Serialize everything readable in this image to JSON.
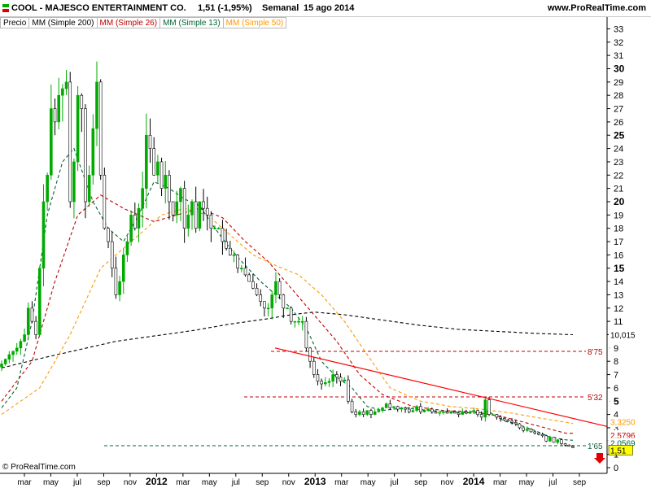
{
  "header": {
    "ticker": "COOL - MAJESCO ENTERTAINMENT CO.",
    "last": "1,51 (-1,95%)",
    "period": "Semanal",
    "date": "15 ago 2014",
    "site": "www.ProRealTime.com"
  },
  "legend": {
    "items": [
      {
        "label": "Precio",
        "color": "#000000"
      },
      {
        "label": "MM (Simple 200)",
        "color": "#000000"
      },
      {
        "label": "MM (Simple 26)",
        "color": "#c00000"
      },
      {
        "label": "MM (Simple 13)",
        "color": "#006633"
      },
      {
        "label": "MM (Simple 50)",
        "color": "#ff9900"
      }
    ]
  },
  "copyright": "© ProRealTime.com",
  "colors": {
    "up": "#00aa00",
    "down": "#000000",
    "trend": "#ff0000",
    "ma200": "#000000",
    "ma26": "#c00000",
    "ma13": "#006633",
    "ma50": "#ff9900"
  },
  "chart_data": {
    "type": "candlestick",
    "y_ticks": [
      0,
      1,
      2,
      3,
      4,
      5,
      6,
      7,
      8,
      9,
      10,
      11,
      12,
      13,
      14,
      15,
      16,
      17,
      18,
      19,
      20,
      21,
      22,
      23,
      24,
      25,
      26,
      27,
      28,
      29,
      30,
      31,
      32,
      33
    ],
    "y_bold_ticks": [
      5,
      10,
      15,
      20,
      25,
      30
    ],
    "x_labels": [
      "mar",
      "may",
      "jul",
      "sep",
      "nov",
      "2012",
      "mar",
      "may",
      "jul",
      "sep",
      "nov",
      "2013",
      "mar",
      "may",
      "jul",
      "sep",
      "nov",
      "2014",
      "mar",
      "may",
      "jul",
      "sep"
    ],
    "x_bold_labels": [
      "2012",
      "2013",
      "2014"
    ],
    "price_labels": [
      {
        "text": "10,015",
        "value": 10.015,
        "color": "#000000",
        "bg": "#ffffff"
      },
      {
        "text": "8'75",
        "value": 8.75,
        "color": "#c00000",
        "bg": "#ffffff"
      },
      {
        "text": "5'32",
        "value": 5.32,
        "color": "#c00000",
        "bg": "#ffffff"
      },
      {
        "text": "3,3250",
        "value": 3.325,
        "color": "#ff9900",
        "bg": "#ffffff"
      },
      {
        "text": "2,5796",
        "value": 2.5796,
        "color": "#c00000",
        "bg": "#ffffff"
      },
      {
        "text": "2,0569",
        "value": 2.0569,
        "color": "#006633",
        "bg": "#ffffff"
      },
      {
        "text": "1'65",
        "value": 1.65,
        "color": "#006633",
        "bg": "#ffffff"
      },
      {
        "text": "1,51",
        "value": 1.51,
        "color": "#000000",
        "bg": "#ffff00"
      }
    ],
    "h_lines": [
      {
        "value": 8.75,
        "color": "#c00000"
      },
      {
        "value": 5.32,
        "color": "#c00000"
      },
      {
        "value": 1.65,
        "color": "#006633"
      }
    ],
    "trendline": {
      "from": [
        0,
        9
      ],
      "to": [
        1,
        3.1
      ]
    },
    "price_anchors": [
      [
        0,
        7.8
      ],
      [
        2,
        8.5
      ],
      [
        4,
        9
      ],
      [
        6,
        10
      ],
      [
        7,
        12
      ],
      [
        8,
        11
      ],
      [
        9,
        10
      ],
      [
        11,
        20
      ],
      [
        12,
        22
      ],
      [
        13,
        27
      ],
      [
        14,
        26
      ],
      [
        15,
        28
      ],
      [
        17,
        29
      ],
      [
        18,
        20
      ],
      [
        19,
        23
      ],
      [
        20,
        28
      ],
      [
        21,
        27
      ],
      [
        22,
        20
      ],
      [
        23,
        22
      ],
      [
        25,
        29
      ],
      [
        26,
        22
      ],
      [
        27,
        18
      ],
      [
        28,
        17
      ],
      [
        29,
        15
      ],
      [
        30,
        13
      ],
      [
        31,
        14
      ],
      [
        32,
        16
      ],
      [
        33,
        17
      ],
      [
        34,
        19
      ],
      [
        35,
        18
      ],
      [
        37,
        21
      ],
      [
        38,
        25
      ],
      [
        39,
        24
      ],
      [
        40,
        22
      ],
      [
        41,
        23
      ],
      [
        42,
        21
      ],
      [
        43,
        22
      ],
      [
        44,
        20
      ],
      [
        45,
        19
      ],
      [
        46,
        20
      ],
      [
        47,
        21
      ],
      [
        48,
        18
      ],
      [
        49,
        19
      ],
      [
        50,
        20
      ],
      [
        51,
        18
      ],
      [
        52,
        20
      ],
      [
        54,
        19
      ],
      [
        55,
        18
      ],
      [
        57,
        18
      ],
      [
        58,
        17
      ],
      [
        60,
        16
      ],
      [
        61,
        16
      ],
      [
        62,
        15
      ],
      [
        63,
        15
      ],
      [
        65,
        14
      ],
      [
        67,
        13
      ],
      [
        69,
        12
      ],
      [
        70,
        12
      ],
      [
        72,
        14
      ],
      [
        73,
        13
      ],
      [
        74,
        12
      ],
      [
        75,
        12
      ],
      [
        76,
        11
      ],
      [
        77,
        11
      ],
      [
        79,
        11
      ],
      [
        80,
        9
      ],
      [
        81,
        8
      ],
      [
        82,
        7
      ],
      [
        83,
        6.5
      ],
      [
        84,
        6.3
      ],
      [
        86,
        6.5
      ],
      [
        87,
        7
      ],
      [
        88,
        6.8
      ],
      [
        89,
        6.5
      ],
      [
        90,
        6.6
      ],
      [
        91,
        5
      ],
      [
        92,
        4.2
      ],
      [
        93,
        4
      ],
      [
        94,
        4.2
      ],
      [
        95,
        4
      ],
      [
        96,
        4.3
      ],
      [
        97,
        4
      ],
      [
        98,
        4.2
      ],
      [
        99,
        4.3
      ],
      [
        100,
        4.5
      ],
      [
        101,
        4.8
      ],
      [
        102,
        4.5
      ],
      [
        103,
        4.6
      ],
      [
        104,
        4.4
      ],
      [
        105,
        4.5
      ],
      [
        106,
        4.4
      ],
      [
        107,
        4.2
      ],
      [
        108,
        4.3
      ],
      [
        109,
        4.6
      ],
      [
        110,
        4.2
      ],
      [
        111,
        4.3
      ],
      [
        112,
        4.4
      ],
      [
        113,
        4.2
      ],
      [
        114,
        4.1
      ],
      [
        116,
        4.2
      ],
      [
        117,
        4.1
      ],
      [
        118,
        4.2
      ],
      [
        120,
        4
      ],
      [
        121,
        4.2
      ],
      [
        122,
        4.1
      ],
      [
        124,
        4.3
      ],
      [
        125,
        4
      ],
      [
        126,
        3.8
      ],
      [
        127,
        5.1
      ],
      [
        128,
        4
      ],
      [
        129,
        4
      ],
      [
        130,
        3.8
      ],
      [
        131,
        3.7
      ],
      [
        132,
        3.6
      ],
      [
        134,
        3.4
      ],
      [
        135,
        3.3
      ],
      [
        136,
        3
      ],
      [
        137,
        2.8
      ],
      [
        138,
        2.9
      ],
      [
        139,
        2.7
      ],
      [
        140,
        2.6
      ],
      [
        141,
        2.5
      ],
      [
        142,
        2.4
      ],
      [
        143,
        2
      ],
      [
        144,
        2.3
      ],
      [
        145,
        1.9
      ],
      [
        146,
        2.1
      ],
      [
        147,
        1.8
      ],
      [
        148,
        1.7
      ],
      [
        149,
        1.6
      ],
      [
        150,
        1.51
      ]
    ],
    "ma200_anchors": [
      [
        0,
        7.5
      ],
      [
        10,
        8.2
      ],
      [
        30,
        9.5
      ],
      [
        50,
        10.3
      ],
      [
        60,
        10.8
      ],
      [
        70,
        11.2
      ],
      [
        76,
        11.5
      ],
      [
        82,
        11.7
      ],
      [
        90,
        11.5
      ],
      [
        100,
        11.1
      ],
      [
        110,
        10.7
      ],
      [
        120,
        10.4
      ],
      [
        140,
        10.1
      ],
      [
        150,
        10.0
      ]
    ],
    "ma26_anchors": [
      [
        0,
        5
      ],
      [
        8,
        8
      ],
      [
        14,
        14
      ],
      [
        20,
        19
      ],
      [
        26,
        20.5
      ],
      [
        32,
        19.5
      ],
      [
        40,
        18.5
      ],
      [
        46,
        19
      ],
      [
        52,
        19.5
      ],
      [
        58,
        18.8
      ],
      [
        64,
        17
      ],
      [
        70,
        15.5
      ],
      [
        76,
        13.5
      ],
      [
        82,
        11.5
      ],
      [
        88,
        9.5
      ],
      [
        94,
        7
      ],
      [
        100,
        5.5
      ],
      [
        108,
        4.6
      ],
      [
        116,
        4.3
      ],
      [
        124,
        4.2
      ],
      [
        132,
        3.8
      ],
      [
        140,
        3.2
      ],
      [
        148,
        2.6
      ],
      [
        150,
        2.58
      ]
    ],
    "ma50_anchors": [
      [
        0,
        4
      ],
      [
        10,
        6
      ],
      [
        18,
        10
      ],
      [
        26,
        15
      ],
      [
        34,
        17
      ],
      [
        42,
        19
      ],
      [
        48,
        19.5
      ],
      [
        54,
        19
      ],
      [
        60,
        17.5
      ],
      [
        66,
        16
      ],
      [
        72,
        15.2
      ],
      [
        78,
        14.5
      ],
      [
        84,
        13
      ],
      [
        90,
        11
      ],
      [
        96,
        8.5
      ],
      [
        102,
        6
      ],
      [
        110,
        5
      ],
      [
        118,
        4.6
      ],
      [
        126,
        4.4
      ],
      [
        134,
        4.1
      ],
      [
        142,
        3.7
      ],
      [
        150,
        3.325
      ]
    ],
    "ma13_anchors": [
      [
        0,
        4.5
      ],
      [
        4,
        6
      ],
      [
        8,
        11
      ],
      [
        12,
        19
      ],
      [
        16,
        23
      ],
      [
        19,
        24
      ],
      [
        24,
        20
      ],
      [
        28,
        18
      ],
      [
        32,
        17
      ],
      [
        36,
        19
      ],
      [
        40,
        21.5
      ],
      [
        44,
        21
      ],
      [
        48,
        20.2
      ],
      [
        52,
        19.7
      ],
      [
        56,
        18
      ],
      [
        60,
        16.5
      ],
      [
        64,
        15.2
      ],
      [
        68,
        14
      ],
      [
        72,
        13
      ],
      [
        76,
        12
      ],
      [
        80,
        10.5
      ],
      [
        84,
        8
      ],
      [
        88,
        6.8
      ],
      [
        92,
        6
      ],
      [
        96,
        4.6
      ],
      [
        100,
        4.3
      ],
      [
        106,
        4.5
      ],
      [
        112,
        4.3
      ],
      [
        118,
        4.2
      ],
      [
        124,
        4.1
      ],
      [
        128,
        4.2
      ],
      [
        132,
        3.5
      ],
      [
        136,
        3.2
      ],
      [
        140,
        2.8
      ],
      [
        144,
        2.3
      ],
      [
        148,
        2.1
      ],
      [
        150,
        2.06
      ]
    ]
  }
}
